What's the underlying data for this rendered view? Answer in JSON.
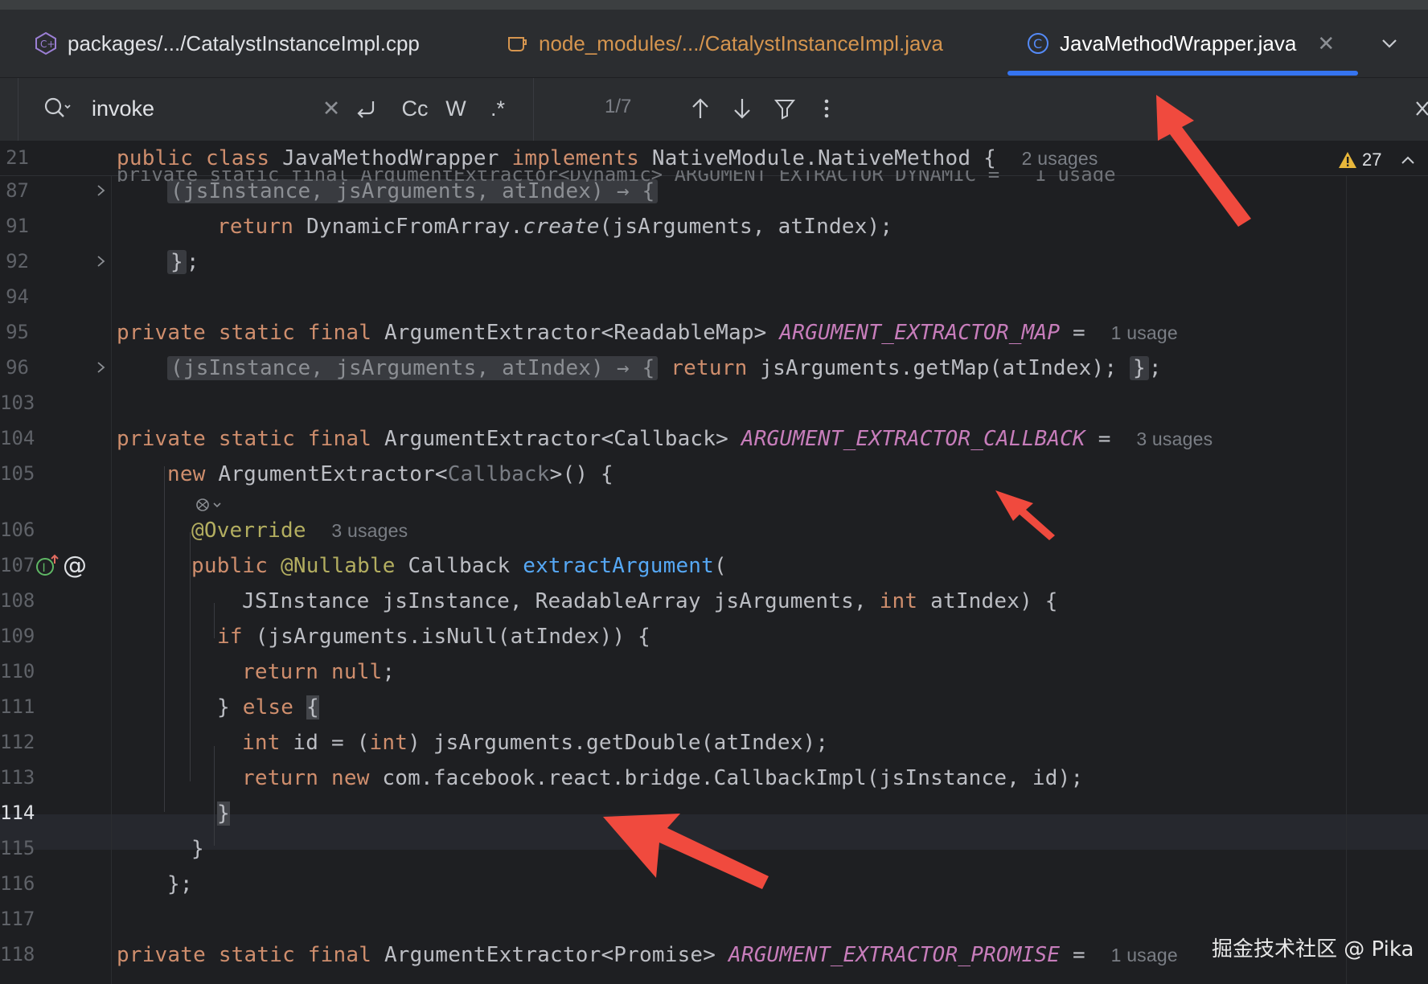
{
  "tabs": [
    {
      "label": "packages/.../CatalystInstanceImpl.cpp",
      "icon": "cpp-file-icon"
    },
    {
      "label": "node_modules/.../CatalystInstanceImpl.java",
      "icon": "java-source-icon"
    },
    {
      "label": "JavaMethodWrapper.java",
      "icon": "java-class-icon",
      "active": true
    }
  ],
  "search": {
    "query": "invoke",
    "match_case": "Cc",
    "words": "W",
    "regex": ".*",
    "match_count": "1/7"
  },
  "sticky": {
    "line": "21",
    "kw_public": "public",
    "kw_class": "class",
    "class_name": "JavaMethodWrapper",
    "kw_implements": "implements",
    "iface": "NativeModule.NativeMethod {",
    "usages": "2 usages",
    "ghost": "private static final ArgumentExtractor<Dynamic> ARGUMENT_EXTRACTOR_DYNAMIC =   1 usage"
  },
  "warnings": {
    "count": "27"
  },
  "lines": {
    "l87": {
      "n": "87",
      "folded": "(jsInstance, jsArguments, atIndex) → {"
    },
    "l91": {
      "n": "91",
      "kw": "return",
      "pre": "DynamicFromArray.",
      "call": "create",
      "post": "(jsArguments, atIndex);"
    },
    "l92": {
      "n": "92",
      "brace": "}",
      "semi": ";"
    },
    "l94": {
      "n": "94"
    },
    "l95": {
      "n": "95",
      "kw": "private static final",
      "type": "ArgumentExtractor<ReadableMap>",
      "field": "ARGUMENT_EXTRACTOR_MAP",
      "eq": "=",
      "usages": "1 usage"
    },
    "l96": {
      "n": "96",
      "folded": "(jsInstance, jsArguments, atIndex) → {",
      "kw": "return",
      "body": "jsArguments.getMap(atIndex);",
      "close": "}",
      "semi": ";"
    },
    "l103": {
      "n": "103"
    },
    "l104": {
      "n": "104",
      "kw": "private static final",
      "type": "ArgumentExtractor<Callback>",
      "field": "ARGUMENT_EXTRACTOR_CALLBACK",
      "eq": "=",
      "usages": "3 usages"
    },
    "l105": {
      "n": "105",
      "kw": "new",
      "pre": "ArgumentExtractor<",
      "generic": "Callback",
      "post": ">() {"
    },
    "l106": {
      "n": "106",
      "ann": "@Override",
      "usages": "3 usages"
    },
    "l107": {
      "n": "107",
      "kw": "public",
      "ann": "@Nullable",
      "type": "Callback",
      "method": "extractArgument",
      "open": "("
    },
    "l108": {
      "n": "108",
      "a": "JSInstance jsInstance, ReadableArray jsArguments,",
      "kw": "int",
      "b": "atIndex) {"
    },
    "l109": {
      "n": "109",
      "kw": "if",
      "body": "(jsArguments.isNull(atIndex)) {"
    },
    "l110": {
      "n": "110",
      "kw": "return",
      "kw2": "null",
      "semi": ";"
    },
    "l111": {
      "n": "111",
      "close": "}",
      "kw": "else",
      "open": "{"
    },
    "l112": {
      "n": "112",
      "kw": "int",
      "a": "id = (",
      "kw2": "int",
      "b": ") jsArguments.getDouble(atIndex);"
    },
    "l113": {
      "n": "113",
      "kw": "return",
      "kw2": "new",
      "body": "com.facebook.react.bridge.CallbackImpl(jsInstance, id);"
    },
    "l114": {
      "n": "114",
      "close": "}"
    },
    "l115": {
      "n": "115",
      "close": "}"
    },
    "l116": {
      "n": "116",
      "close": "};"
    },
    "l117": {
      "n": "117"
    },
    "l118": {
      "n": "118",
      "kw": "private static final",
      "type": "ArgumentExtractor<Promise>",
      "field": "ARGUMENT_EXTRACTOR_PROMISE",
      "eq": "=",
      "usages": "1 usage"
    }
  },
  "watermark": "掘金技术社区 @ Pika",
  "colors": {
    "keyword": "#cf8e6d",
    "field": "#c77dbb",
    "method": "#56a8f5",
    "annotation": "#b3ae60",
    "accent": "#3574f0",
    "arrow": "#f04a3e"
  }
}
